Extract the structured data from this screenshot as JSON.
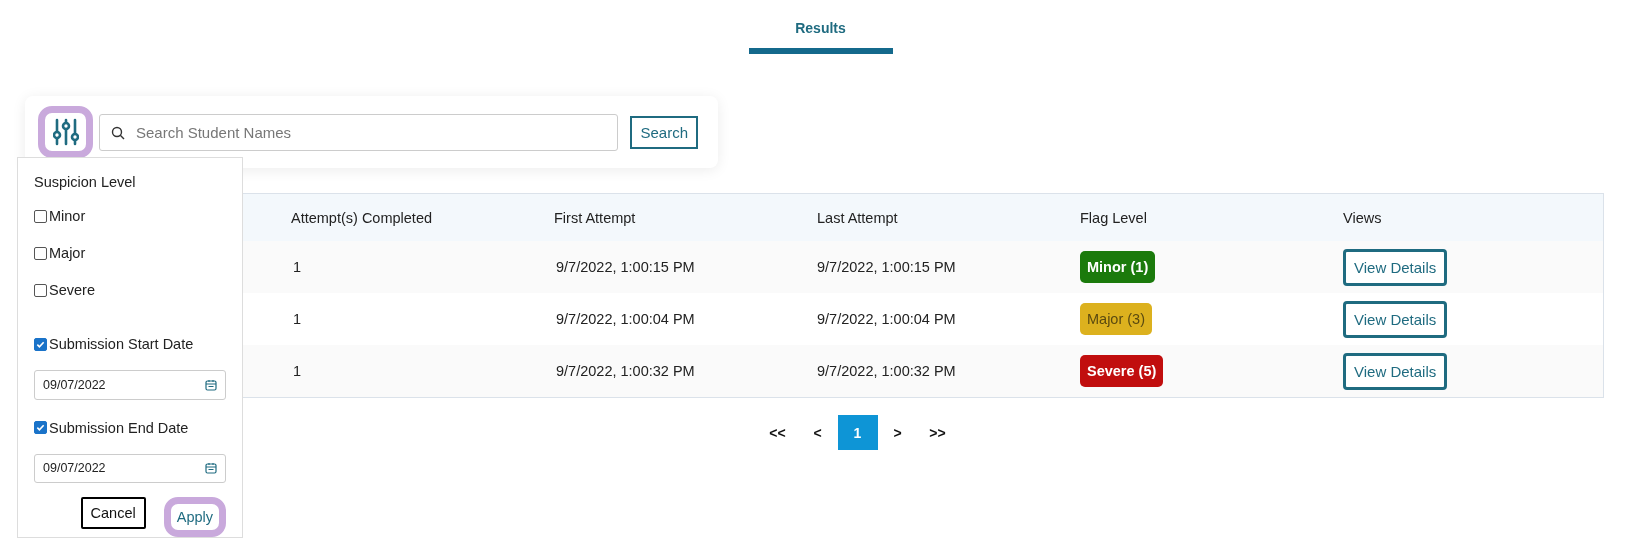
{
  "tabs": [
    {
      "label": "Results",
      "selected": true
    }
  ],
  "search": {
    "placeholder": "Search Student Names",
    "button": "Search"
  },
  "filter_panel": {
    "title": "Suspicion Level",
    "levels": [
      {
        "label": "Minor",
        "checked": false
      },
      {
        "label": "Major",
        "checked": false
      },
      {
        "label": "Severe",
        "checked": false
      }
    ],
    "dates": [
      {
        "label": "Submission Start Date",
        "checked": true,
        "value": "09/07/2022"
      },
      {
        "label": "Submission End Date",
        "checked": true,
        "value": "09/07/2022"
      }
    ],
    "buttons": [
      {
        "label": "Cancel",
        "kind": "outline"
      },
      {
        "label": "Apply",
        "kind": "highlight"
      }
    ]
  },
  "table": {
    "columns": [
      "Attempt(s) Completed",
      "First Attempt",
      "Last Attempt",
      "Flag Level",
      "Views"
    ],
    "rows": [
      {
        "attempts": "1",
        "first": "9/7/2022, 1:00:15 PM",
        "last": "9/7/2022, 1:00:15 PM",
        "flag": {
          "label": "Minor (1)",
          "color": "#1b7a0c"
        },
        "action": "View Details"
      },
      {
        "attempts": "1",
        "first": "9/7/2022, 1:00:04 PM",
        "last": "9/7/2022, 1:00:04 PM",
        "flag": {
          "label": "Major (3)",
          "color": "#dcb11e"
        },
        "action": "View Details"
      },
      {
        "attempts": "1",
        "first": "9/7/2022, 1:00:32 PM",
        "last": "9/7/2022, 1:00:32 PM",
        "flag": {
          "label": "Severe (5)",
          "color": "#c10e0e"
        },
        "action": "View Details"
      }
    ]
  },
  "pagination": [
    {
      "label": "<<",
      "selected": false
    },
    {
      "label": "<",
      "selected": false
    },
    {
      "label": "1",
      "selected": true
    },
    {
      "label": ">",
      "selected": false
    },
    {
      "label": ">>",
      "selected": false
    }
  ]
}
